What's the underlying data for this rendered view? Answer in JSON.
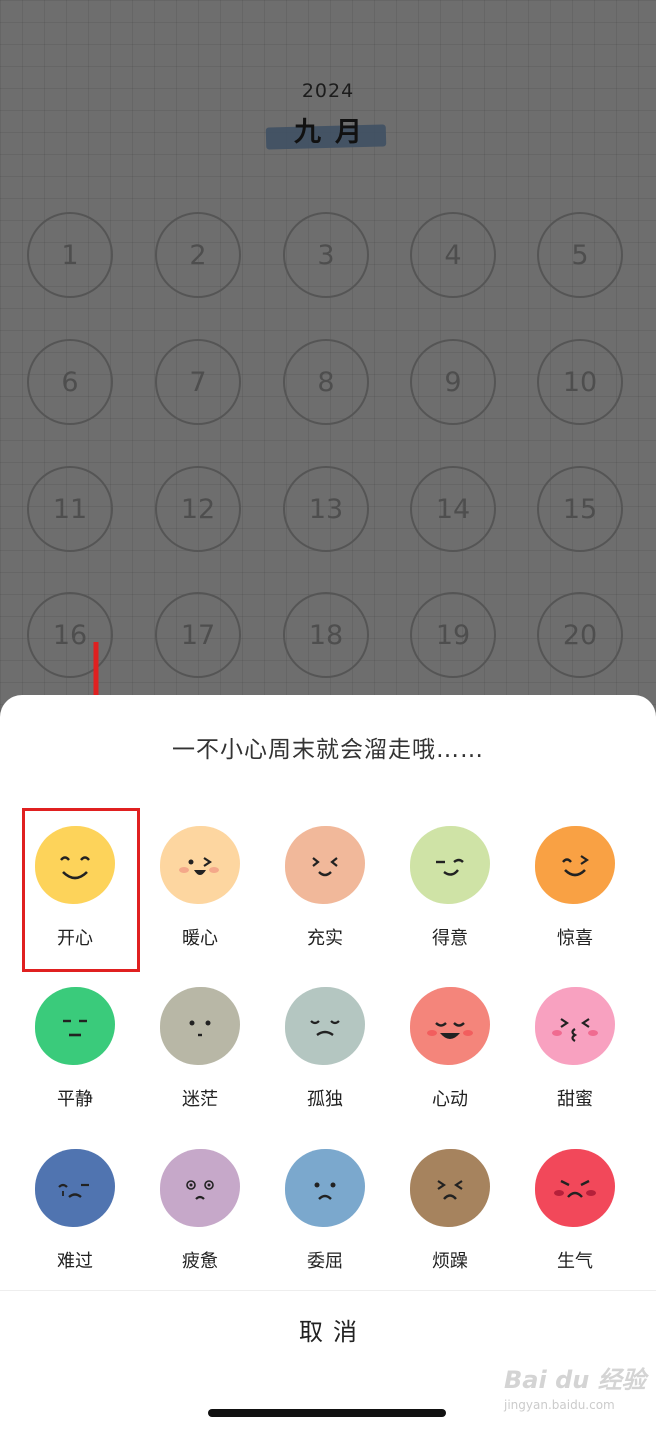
{
  "calendar": {
    "year": "2024",
    "month": "九月",
    "days": [
      "1",
      "2",
      "3",
      "4",
      "5",
      "6",
      "7",
      "8",
      "9",
      "10",
      "11",
      "12",
      "13",
      "14",
      "15",
      "16",
      "17",
      "18",
      "19",
      "20"
    ]
  },
  "sheet": {
    "title": "一不小心周末就会溜走哦……",
    "cancel_label": "取消",
    "moods": [
      {
        "label": "开心",
        "color": "#FDD35A"
      },
      {
        "label": "暖心",
        "color": "#FDD6A0"
      },
      {
        "label": "充实",
        "color": "#F1B89A"
      },
      {
        "label": "得意",
        "color": "#CFE3A6"
      },
      {
        "label": "惊喜",
        "color": "#F9A144"
      },
      {
        "label": "平静",
        "color": "#3ACB7B"
      },
      {
        "label": "迷茫",
        "color": "#B8B7A6"
      },
      {
        "label": "孤独",
        "color": "#B4C6C1"
      },
      {
        "label": "心动",
        "color": "#F4857B"
      },
      {
        "label": "甜蜜",
        "color": "#F8A1C0"
      },
      {
        "label": "难过",
        "color": "#5074B0"
      },
      {
        "label": "疲惫",
        "color": "#C6A8C9"
      },
      {
        "label": "委屈",
        "color": "#7BA8CD"
      },
      {
        "label": "烦躁",
        "color": "#A6835E"
      },
      {
        "label": "生气",
        "color": "#F2485A"
      }
    ]
  },
  "watermark": {
    "brand": "Bai du 经验",
    "url": "jingyan.baidu.com"
  },
  "colors": {
    "highlight": "#E02020",
    "overlay": "#6E6E6E"
  }
}
